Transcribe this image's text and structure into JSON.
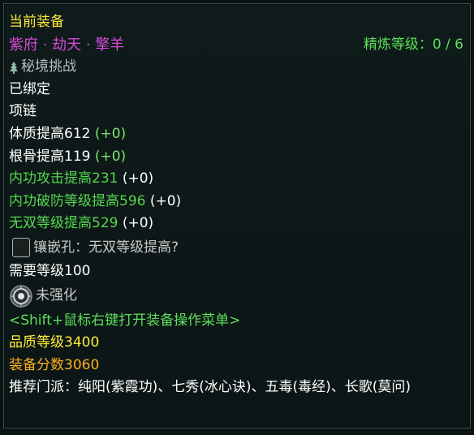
{
  "header": {
    "current_equip": "当前装备"
  },
  "item": {
    "name": "紫府 · 劫天 · 擎羊",
    "refine": "精炼等级：0 / 6",
    "source": "秘境挑战",
    "bound": "已绑定",
    "slot": "项链"
  },
  "stats": [
    {
      "label": "体质提高612",
      "bonus": "(+0)"
    },
    {
      "label": "根骨提高119",
      "bonus": "(+0)"
    },
    {
      "label": "内功攻击提高231",
      "bonus": "(+0)"
    },
    {
      "label": "内功破防等级提高596",
      "bonus": "(+0)"
    },
    {
      "label": "无双等级提高529",
      "bonus": "(+0)"
    }
  ],
  "socket": {
    "text": "镶嵌孔：无双等级提高?"
  },
  "requirement": "需要等级100",
  "enhance": {
    "text": "未强化"
  },
  "hint": "<Shift+鼠标右键打开装备操作菜单>",
  "quality": "品质等级3400",
  "score": "装备分数3060",
  "school": "推荐门派：纯阳(紫霞功)、七秀(冰心诀)、五毒(毒经)、长歌(莫问)",
  "icons": {
    "source_icon": "pine-tree-icon",
    "socket_icon": "empty-socket-icon",
    "enhance_icon": "disc-gear-icon"
  },
  "colors": {
    "title": "#ffeb3b",
    "name": "#d44bd4",
    "green": "#54d84f",
    "orange": "#ffb11d"
  }
}
